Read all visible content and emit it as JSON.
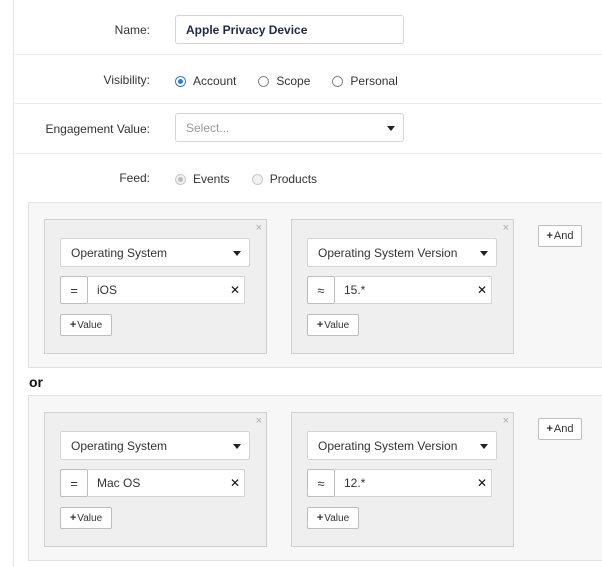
{
  "form": {
    "name": {
      "label": "Name:",
      "value": "Apple Privacy Device"
    },
    "visibility": {
      "label": "Visibility:",
      "options": [
        {
          "label": "Account",
          "checked": true
        },
        {
          "label": "Scope",
          "checked": false
        },
        {
          "label": "Personal",
          "checked": false
        }
      ]
    },
    "engagement": {
      "label": "Engagement Value:",
      "placeholder": "Select..."
    },
    "feed": {
      "label": "Feed:",
      "options": [
        {
          "label": "Events",
          "checked": true,
          "disabled": true
        },
        {
          "label": "Products",
          "checked": false,
          "disabled": true
        }
      ]
    }
  },
  "groups": [
    {
      "conditions": [
        {
          "field": "Operating System",
          "operator": "=",
          "value": "iOS",
          "value_button": "Value"
        },
        {
          "field": "Operating System Version",
          "operator": "≈",
          "value": "15.*",
          "value_button": "Value"
        }
      ],
      "and_button": "And"
    },
    {
      "conditions": [
        {
          "field": "Operating System",
          "operator": "=",
          "value": "Mac OS",
          "value_button": "Value"
        },
        {
          "field": "Operating System Version",
          "operator": "≈",
          "value": "12.*",
          "value_button": "Value"
        }
      ],
      "and_button": "And"
    }
  ],
  "or_label": "or",
  "icons": {
    "close": "×",
    "clear": "✕",
    "plus": "+"
  }
}
